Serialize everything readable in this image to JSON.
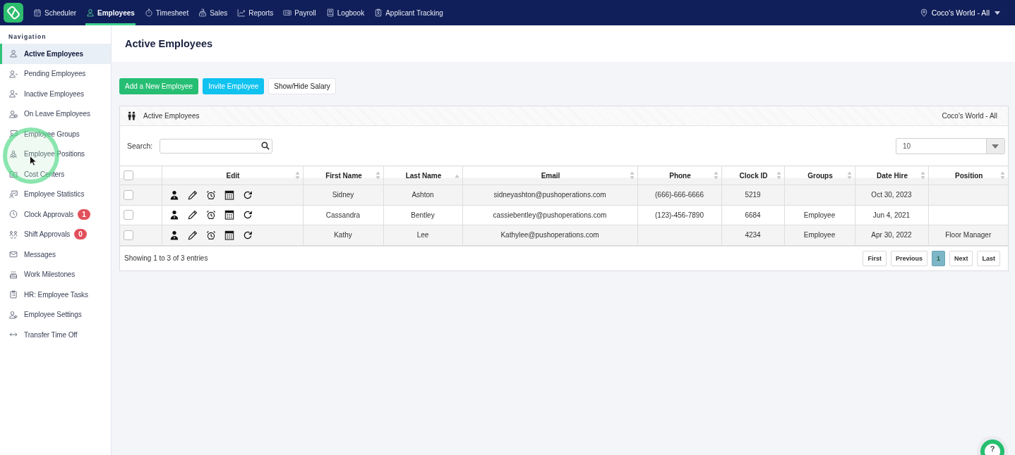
{
  "top_nav": {
    "items": [
      {
        "label": "Scheduler",
        "selected": false
      },
      {
        "label": "Employees",
        "selected": true
      },
      {
        "label": "Timesheet",
        "selected": false
      },
      {
        "label": "Sales",
        "selected": false
      },
      {
        "label": "Reports",
        "selected": false
      },
      {
        "label": "Payroll",
        "selected": false
      },
      {
        "label": "Logbook",
        "selected": false
      },
      {
        "label": "Applicant Tracking",
        "selected": false
      }
    ],
    "location": "Coco's World - All"
  },
  "sidebar": {
    "heading": "Navigation",
    "items": [
      {
        "label": "Active Employees",
        "selected": true
      },
      {
        "label": "Pending Employees",
        "selected": false
      },
      {
        "label": "Inactive Employees",
        "selected": false
      },
      {
        "label": "On Leave Employees",
        "selected": false
      },
      {
        "label": "Employee Groups",
        "selected": false
      },
      {
        "label": "Employee Positions",
        "selected": false
      },
      {
        "label": "Cost Centers",
        "selected": false
      },
      {
        "label": "Employee Statistics",
        "selected": false
      },
      {
        "label": "Clock Approvals",
        "selected": false,
        "badge": "1"
      },
      {
        "label": "Shift Approvals",
        "selected": false,
        "badge": "0"
      },
      {
        "label": "Messages",
        "selected": false
      },
      {
        "label": "Work Milestones",
        "selected": false
      },
      {
        "label": "HR: Employee Tasks",
        "selected": false
      },
      {
        "label": "Employee Settings",
        "selected": false
      },
      {
        "label": "Transfer Time Off",
        "selected": false
      }
    ]
  },
  "page": {
    "title": "Active Employees",
    "actions": [
      {
        "label": "Add a New Employee",
        "kind": "success"
      },
      {
        "label": "Invite Employee",
        "kind": "info"
      },
      {
        "label": "Show/Hide Salary",
        "kind": "default"
      }
    ]
  },
  "panel": {
    "title": "Active Employees",
    "location": "Coco's World - All",
    "search": {
      "label": "Search:"
    },
    "page_size": "10"
  },
  "table": {
    "select_all": {
      "checked": false
    },
    "columns": [
      {
        "label": "Edit",
        "sorted": false
      },
      {
        "label": "First Name",
        "sorted": false
      },
      {
        "label": "Last Name",
        "sorted": true
      },
      {
        "label": "Email",
        "sorted": false
      },
      {
        "label": "Phone",
        "sorted": false
      },
      {
        "label": "Clock ID",
        "sorted": false
      },
      {
        "label": "Groups",
        "sorted": false
      },
      {
        "label": "Date Hire",
        "sorted": false
      },
      {
        "label": "Position",
        "sorted": false
      }
    ],
    "rows": [
      {
        "checked": false,
        "first_name": "Sidney",
        "last_name": "Ashton",
        "email": "sidneyashton@pushoperations.com",
        "phone": "(666)-666-6666",
        "clock_id": "5219",
        "date_hire": "Oct 30, 2023"
      },
      {
        "checked": false,
        "first_name": "Cassandra",
        "last_name": "Bentley",
        "email": "cassiebentley@pushoperations.com",
        "phone": "(123)-456-7890",
        "clock_id": "6684",
        "groups": "Employee",
        "date_hire": "Jun 4, 2021"
      },
      {
        "checked": false,
        "first_name": "Kathy",
        "last_name": "Lee",
        "email": "Kathylee@pushoperations.com",
        "clock_id": "4234",
        "groups": "Employee",
        "date_hire": "Apr 30, 2022",
        "position": "Floor Manager"
      }
    ]
  },
  "footer": {
    "info": "Showing 1 to 3 of 3 entries",
    "pagination": [
      {
        "label": "First",
        "selected": false
      },
      {
        "label": "Previous",
        "selected": false
      },
      {
        "label": "1",
        "selected": true
      },
      {
        "label": "Next",
        "selected": false
      },
      {
        "label": "Last",
        "selected": false
      }
    ]
  },
  "help_button": {
    "label": "?"
  }
}
